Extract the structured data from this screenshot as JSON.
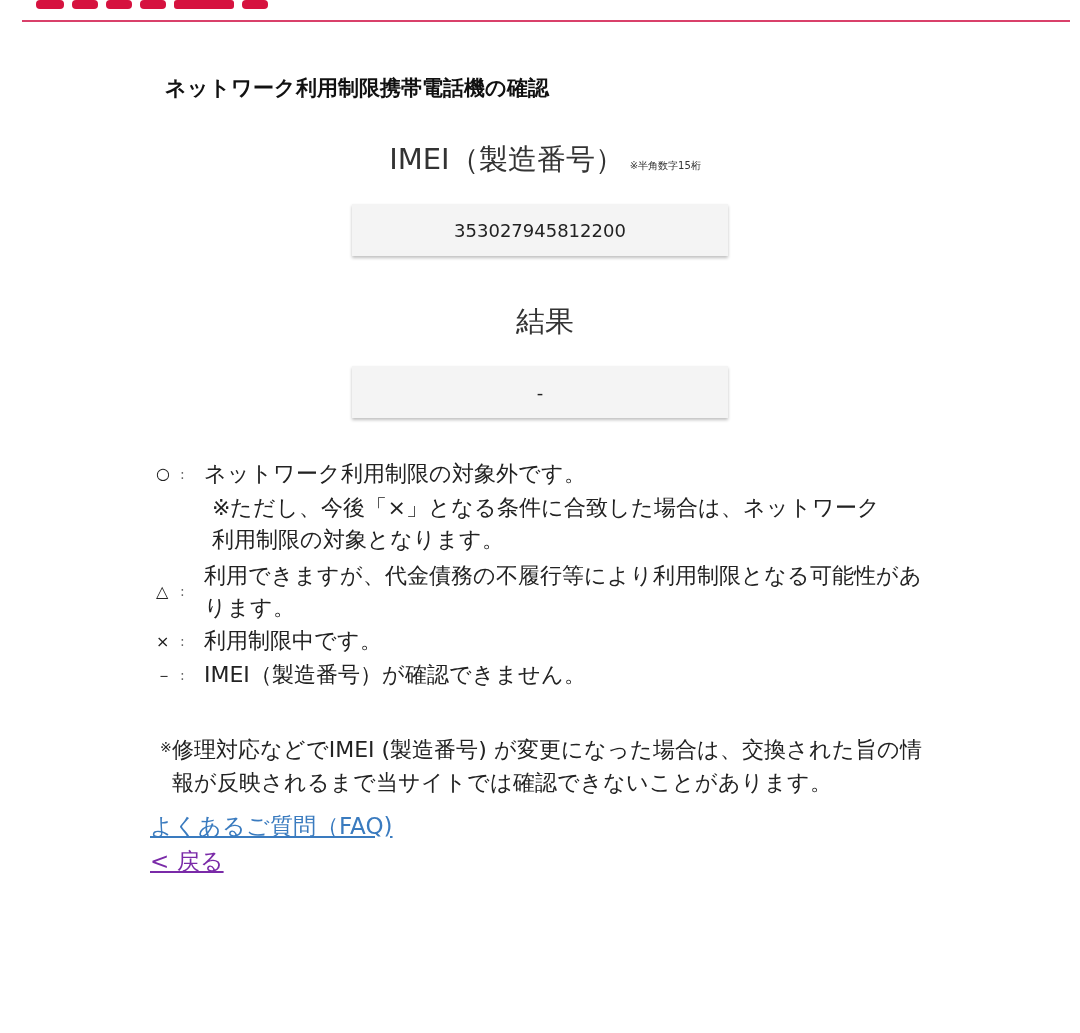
{
  "title": "ネットワーク利用制限携帯電話機の確認",
  "imei": {
    "label": "IMEI（製造番号）",
    "note": "※半角数字15桁",
    "value": "353027945812200"
  },
  "result": {
    "label": "結果",
    "value": "-"
  },
  "legend": [
    {
      "symbol": "○",
      "separator": ":",
      "text": "ネットワーク利用制限の対象外です。",
      "note": "※ただし、今後「×」となる条件に合致した場合は、ネットワーク利用制限の対象となります。"
    },
    {
      "symbol": "△",
      "separator": ":",
      "text": "利用できますが、代金債務の不履行等により利用制限となる可能性があります。"
    },
    {
      "symbol": "×",
      "separator": ":",
      "text": "利用制限中です。"
    },
    {
      "symbol": "－",
      "separator": ":",
      "text": "IMEI（製造番号）が確認できません。"
    }
  ],
  "footnote": {
    "mark": "※",
    "text": "修理対応などでIMEI (製造番号) が変更になった場合は、交換された旨の情報が反映されるまで当サイトでは確認できないことがあります。"
  },
  "links": [
    {
      "label": "よくあるご質問（FAQ)",
      "visited": false
    },
    {
      "label": "< 戻る",
      "visited": true
    }
  ]
}
